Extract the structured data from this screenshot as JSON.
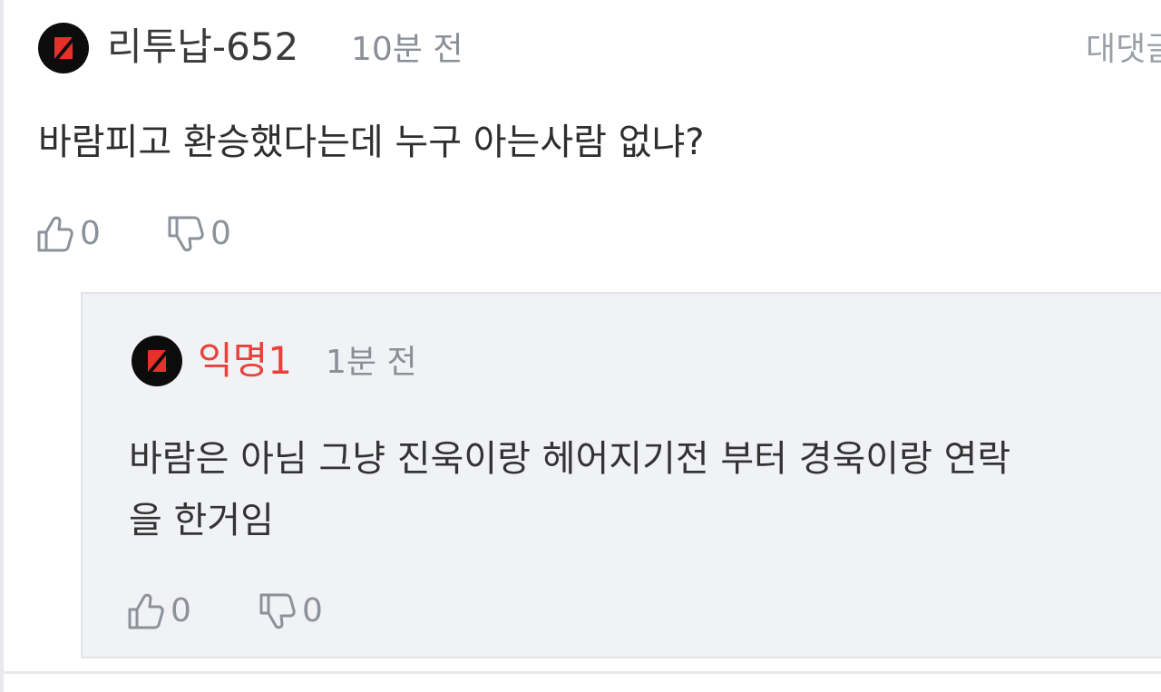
{
  "comment": {
    "username": "리투납-652",
    "timestamp": "10분 전",
    "reply_label": "대댓글",
    "body": "바람피고 환승했다는데 누구 아는사람 없냐?",
    "likes": "0",
    "dislikes": "0"
  },
  "reply": {
    "username": "익명1",
    "timestamp": "1분 전",
    "body": "바람은 아님 그냥 진욱이랑 헤어지기전 부터 경욱이랑 연락\n을 한거임",
    "likes": "0",
    "dislikes": "0"
  },
  "colors": {
    "accent_red": "#e8413b",
    "muted_gray": "#8a8f98",
    "reply_bg": "#f1f2f5"
  }
}
